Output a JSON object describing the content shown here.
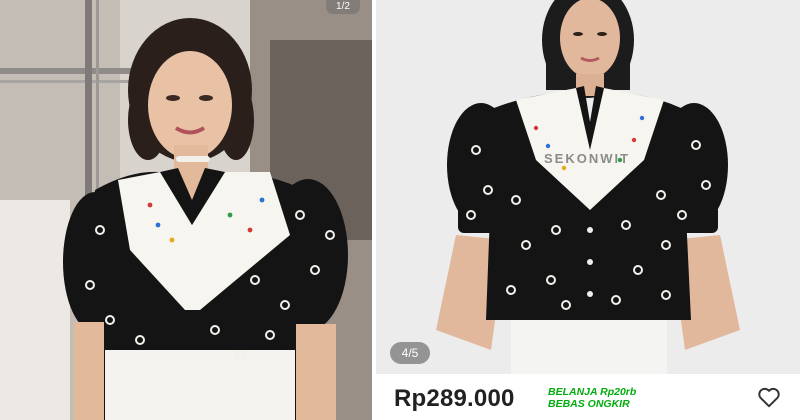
{
  "left_photo": {
    "counter": "1/2",
    "icon": "person-photo"
  },
  "product": {
    "watermark": "SEKONWIT",
    "page_indicator": "4/5",
    "price": "Rp289.000",
    "promo_line1": "BELANJA Rp20rb",
    "promo_line2": "BEBAS ONGKIR",
    "wishlist_icon": "heart-icon"
  },
  "colors": {
    "price_text": "#212121",
    "promo_green": "#03ac0e",
    "blouse_black": "#141414",
    "collar_white": "#f7f5ef"
  }
}
